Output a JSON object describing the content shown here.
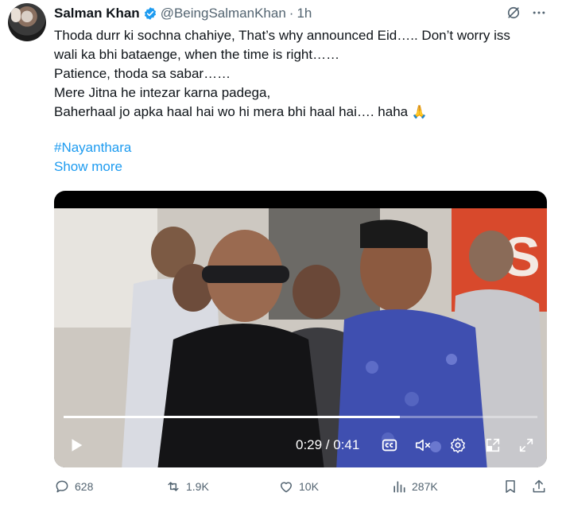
{
  "author": {
    "name": "Salman Khan",
    "handle": "@BeingSalmanKhan",
    "separator": "·",
    "time": "1h"
  },
  "tweet": {
    "lines": [
      "Thoda durr ki sochna chahiye, That’s why announced Eid….. Don’t worry iss",
      "wali ka bhi bataenge, when the time is right……",
      "Patience, thoda sa sabar……",
      "Mere Jitna he intezar karna padega,",
      "Baherhaal jo apka haal hai wo hi mera bhi haal hai…. haha"
    ],
    "emoji": "🙏",
    "hashtag": "#Nayanthara",
    "show_more": "Show more"
  },
  "video": {
    "timecode": "0:29 / 0:41",
    "progress": 0.71
  },
  "actions": {
    "replies": "628",
    "reposts": "1.9K",
    "likes": "10K",
    "views": "287K"
  },
  "colors": {
    "accent": "#1d9bf0",
    "muted": "#536471",
    "text": "#0f1419"
  },
  "icons": [
    "verified-badge-icon",
    "grok-icon",
    "more-icon",
    "play-icon",
    "captions-icon",
    "mute-icon",
    "settings-icon",
    "pip-icon",
    "fullscreen-icon",
    "reply-icon",
    "repost-icon",
    "like-icon",
    "views-icon",
    "bookmark-icon",
    "share-icon"
  ]
}
